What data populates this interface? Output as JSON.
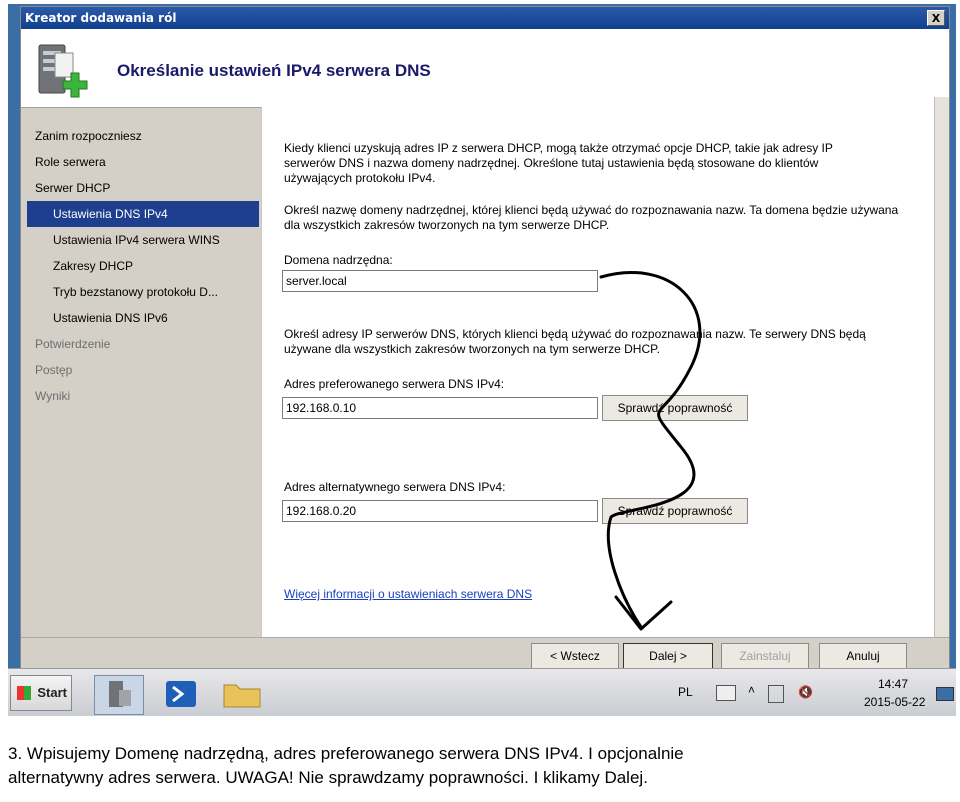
{
  "window": {
    "title": "Kreator dodawania ról",
    "close_label": "X"
  },
  "header": {
    "title": "Określanie ustawień IPv4 serwera DNS"
  },
  "sidebar": {
    "items": [
      {
        "label": "Zanim rozpoczniesz"
      },
      {
        "label": "Role serwera"
      },
      {
        "label": "Serwer DHCP"
      },
      {
        "label": "Ustawienia DNS IPv4"
      },
      {
        "label": "Ustawienia IPv4 serwera WINS"
      },
      {
        "label": "Zakresy DHCP"
      },
      {
        "label": "Tryb bezstanowy protokołu D..."
      },
      {
        "label": "Ustawienia DNS IPv6"
      },
      {
        "label": "Potwierdzenie"
      },
      {
        "label": "Postęp"
      },
      {
        "label": "Wyniki"
      }
    ]
  },
  "content": {
    "intro": "Kiedy klienci uzyskują adres IP z serwera DHCP, mogą także otrzymać opcje DHCP, takie jak adresy IP serwerów DNS i nazwa domeny nadrzędnej. Określone tutaj ustawienia będą stosowane do klientów używających protokołu IPv4.",
    "domain_intro": "Określ nazwę domeny nadrzędnej, której klienci będą używać do rozpoznawania nazw. Ta domena będzie używana dla wszystkich zakresów tworzonych na tym serwerze DHCP.",
    "domain_label": "Domena nadrzędna:",
    "domain_value": "server.local",
    "dns_intro": "Określ adresy IP serwerów DNS, których klienci będą używać do rozpoznawania nazw. Te serwery DNS będą używane dla wszystkich zakresów tworzonych na tym serwerze DHCP.",
    "preferred_label": "Adres preferowanego serwera DNS IPv4:",
    "preferred_value": "192.168.0.10",
    "alternate_label": "Adres alternatywnego serwera DNS IPv4:",
    "alternate_value": "192.168.0.20",
    "validate_label": "Sprawdź poprawność",
    "more_info": "Więcej informacji o ustawieniach serwera DNS"
  },
  "buttons": {
    "back": "< Wstecz",
    "next": "Dalej >",
    "install": "Zainstaluj",
    "cancel": "Anuluj"
  },
  "taskbar": {
    "start": "Start",
    "language": "PL",
    "time": "14:47",
    "date": "2015-05-22"
  },
  "caption": {
    "line1": "3. Wpisujemy Domenę nadrzędną, adres preferowanego serwera DNS IPv4. I opcjonalnie",
    "line2": "alternatywny adres serwera. UWAGA! Nie sprawdzamy poprawności. I klikamy Dalej."
  }
}
